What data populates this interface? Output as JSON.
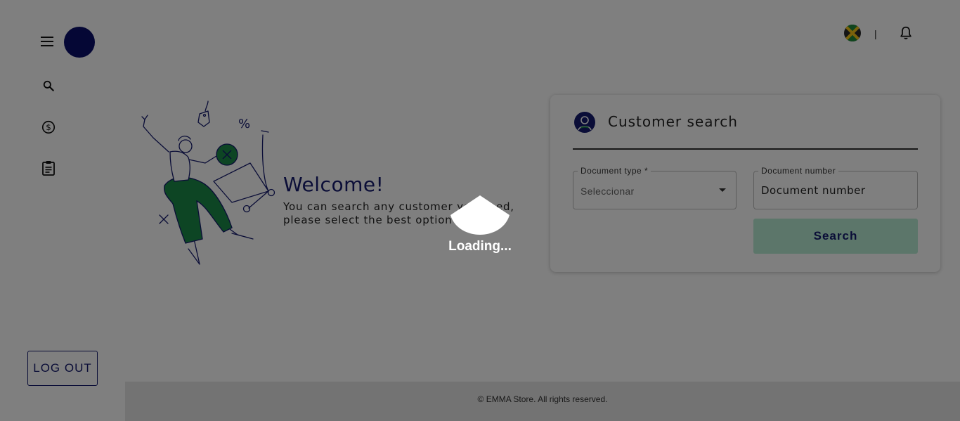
{
  "sidebar": {
    "menu_icon": "hamburger-menu-icon",
    "avatar_color": "#0a0f6b",
    "items": [
      {
        "icon": "search-icon"
      },
      {
        "icon": "dollar-circle-icon"
      },
      {
        "icon": "clipboard-icon"
      }
    ],
    "logout_label": "LOG OUT"
  },
  "topbar": {
    "flag_icon": "jamaica-flag-icon",
    "separator": "|",
    "notifications_icon": "bell-icon"
  },
  "welcome": {
    "title": "Welcome!",
    "subtitle": "You can search any customer you need, please select the best option for you."
  },
  "customer_search": {
    "title": "Customer search",
    "document_type": {
      "label": "Document type *",
      "value": "Seleccionar"
    },
    "document_number": {
      "label": "Document number",
      "placeholder": "Document number"
    },
    "search_label": "Search"
  },
  "footer": {
    "text": "© EMMA Store. All rights reserved."
  },
  "loading": {
    "text": "Loading..."
  },
  "colors": {
    "brand_navy": "#151b6e",
    "accent_green": "#1a8a48",
    "search_button_bg": "#b8ecd4",
    "overlay": "rgba(0,0,0,0.5)"
  }
}
